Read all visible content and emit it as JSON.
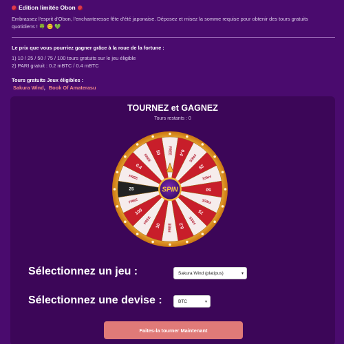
{
  "promo": {
    "edition_title": "Edition limitée Obon",
    "intro": "Embrassez l'esprit d'Obon, l'enchanteresse fête d'été japonaise. Déposez et misez la somme requise pour obtenir des tours gratuits quotidiens ! 🍀 😊 💚",
    "prize_title": "Le prix que vous pourriez gagner grâce à la roue de la fortune :",
    "prize_lines": [
      "1) 10 / 25 / 50 / 75 / 100 tours gratuits sur le jeu éligible",
      "2) PARI gratuit : 0.2 mBTC / 0.4 mBTC"
    ],
    "games_title": "Tours gratuits Jeux éligibles :",
    "games": [
      "Sakura Wind",
      "Book Of Amaterasu"
    ],
    "games_separator": ","
  },
  "wheel_panel": {
    "title": "TOURNEZ et GAGNEZ",
    "spins_remaining": "Tours restants : 0",
    "spin_label": "SPIN",
    "segment_labels": [
      "FREE",
      "0.4",
      "FREE",
      "25",
      "FREE",
      "50",
      "FREE",
      "75",
      "FREE",
      "0.2",
      "FREE",
      "10",
      "FREE",
      "100",
      "FREE",
      "25",
      "FREE",
      "0.4",
      "FREE",
      "50"
    ]
  },
  "form": {
    "game_label": "Sélectionnez un jeu :",
    "game_value": "Sakura Wind (platipus)",
    "currency_label": "Sélectionnez une devise :",
    "currency_value": "BTC",
    "submit_label": "Faites-la tourner Maintenant"
  },
  "colors": {
    "background": "#4a0b6e",
    "panel": "#3c0658",
    "wheel_red": "#c81e2a",
    "wheel_white": "#f6ecec",
    "wheel_rim": "#e39a1f",
    "button": "#e07a78",
    "games_link": "#f08a8a"
  }
}
